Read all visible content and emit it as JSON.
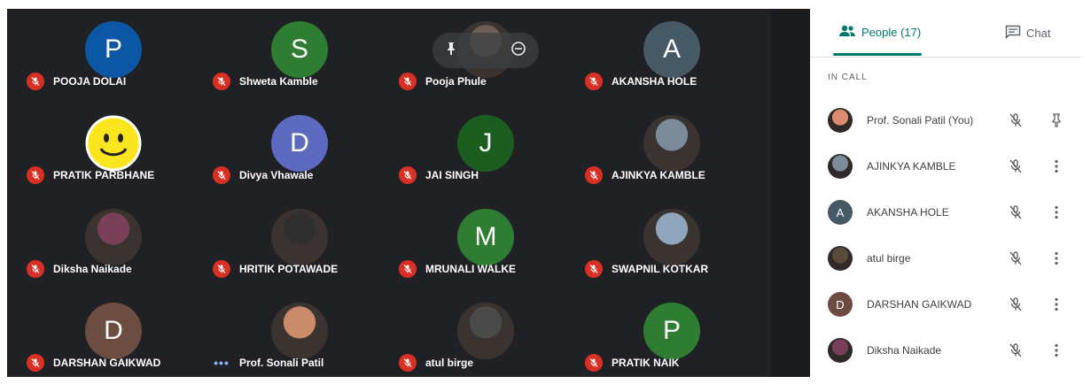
{
  "colors": {
    "accent": "#00796b",
    "muted_red": "#d93025",
    "grid_bg": "#202124"
  },
  "tiles": [
    {
      "name": "POOJA DOLAI",
      "initial": "P",
      "color": "#0b57a5",
      "badge": "mic-off-icon"
    },
    {
      "name": "Shweta Kamble",
      "initial": "S",
      "color": "#2e7d32",
      "badge": "mic-off-icon"
    },
    {
      "name": "Pooja Phule",
      "initial": "",
      "color": "#6f5e55",
      "badge": "mic-off-icon"
    },
    {
      "name": "AKANSHA HOLE",
      "initial": "A",
      "color": "#455a64",
      "badge": "mic-off-icon"
    },
    {
      "name": "PRATIK PARBHANE",
      "initial": "",
      "color": "#f8e71c",
      "badge": "mic-off-icon"
    },
    {
      "name": "Divya Vhawale",
      "initial": "D",
      "color": "#5c6bc0",
      "badge": "mic-off-icon"
    },
    {
      "name": "JAI SINGH",
      "initial": "J",
      "color": "#1b5e20",
      "badge": "mic-off-icon"
    },
    {
      "name": "AJINKYA KAMBLE",
      "initial": "",
      "color": "#7b8b9a",
      "badge": "mic-off-icon"
    },
    {
      "name": "Diksha Naikade",
      "initial": "",
      "color": "#7a3f58",
      "badge": "mic-off-icon"
    },
    {
      "name": "HRITIK POTAWADE",
      "initial": "",
      "color": "#2f2f2f",
      "badge": "mic-off-icon"
    },
    {
      "name": "MRUNALI WALKE",
      "initial": "M",
      "color": "#2e7d32",
      "badge": "mic-off-icon"
    },
    {
      "name": "SWAPNIL KOTKAR",
      "initial": "",
      "color": "#8fa6bd",
      "badge": "mic-off-icon"
    },
    {
      "name": "DARSHAN GAIKWAD",
      "initial": "D",
      "color": "#6d4c41",
      "badge": "mic-off-icon"
    },
    {
      "name": "Prof. Sonali Patil",
      "initial": "",
      "color": "#c98b6a",
      "badge": "more-dots-icon"
    },
    {
      "name": "atul birge",
      "initial": "",
      "color": "#4a4a4a",
      "badge": "mic-off-icon"
    },
    {
      "name": "PRATIK NAIK",
      "initial": "P",
      "color": "#2e7d32",
      "badge": "mic-off-icon"
    }
  ],
  "panel": {
    "people_tab": "People (17)",
    "chat_tab": "Chat",
    "section_label": "IN CALL",
    "people": [
      {
        "name": "Prof. Sonali Patil (You)",
        "initial": "",
        "color": "#d98c6e",
        "action": "pin-icon"
      },
      {
        "name": "AJINKYA KAMBLE",
        "initial": "",
        "color": "#7b8b9a",
        "action": "more-vert-icon"
      },
      {
        "name": "AKANSHA HOLE",
        "initial": "A",
        "color": "#455a64",
        "action": "more-vert-icon"
      },
      {
        "name": "atul birge",
        "initial": "",
        "color": "#5a4a3a",
        "action": "more-vert-icon"
      },
      {
        "name": "DARSHAN GAIKWAD",
        "initial": "D",
        "color": "#6d4c41",
        "action": "more-vert-icon"
      },
      {
        "name": "Diksha Naikade",
        "initial": "",
        "color": "#7a3f58",
        "action": "more-vert-icon"
      }
    ]
  }
}
